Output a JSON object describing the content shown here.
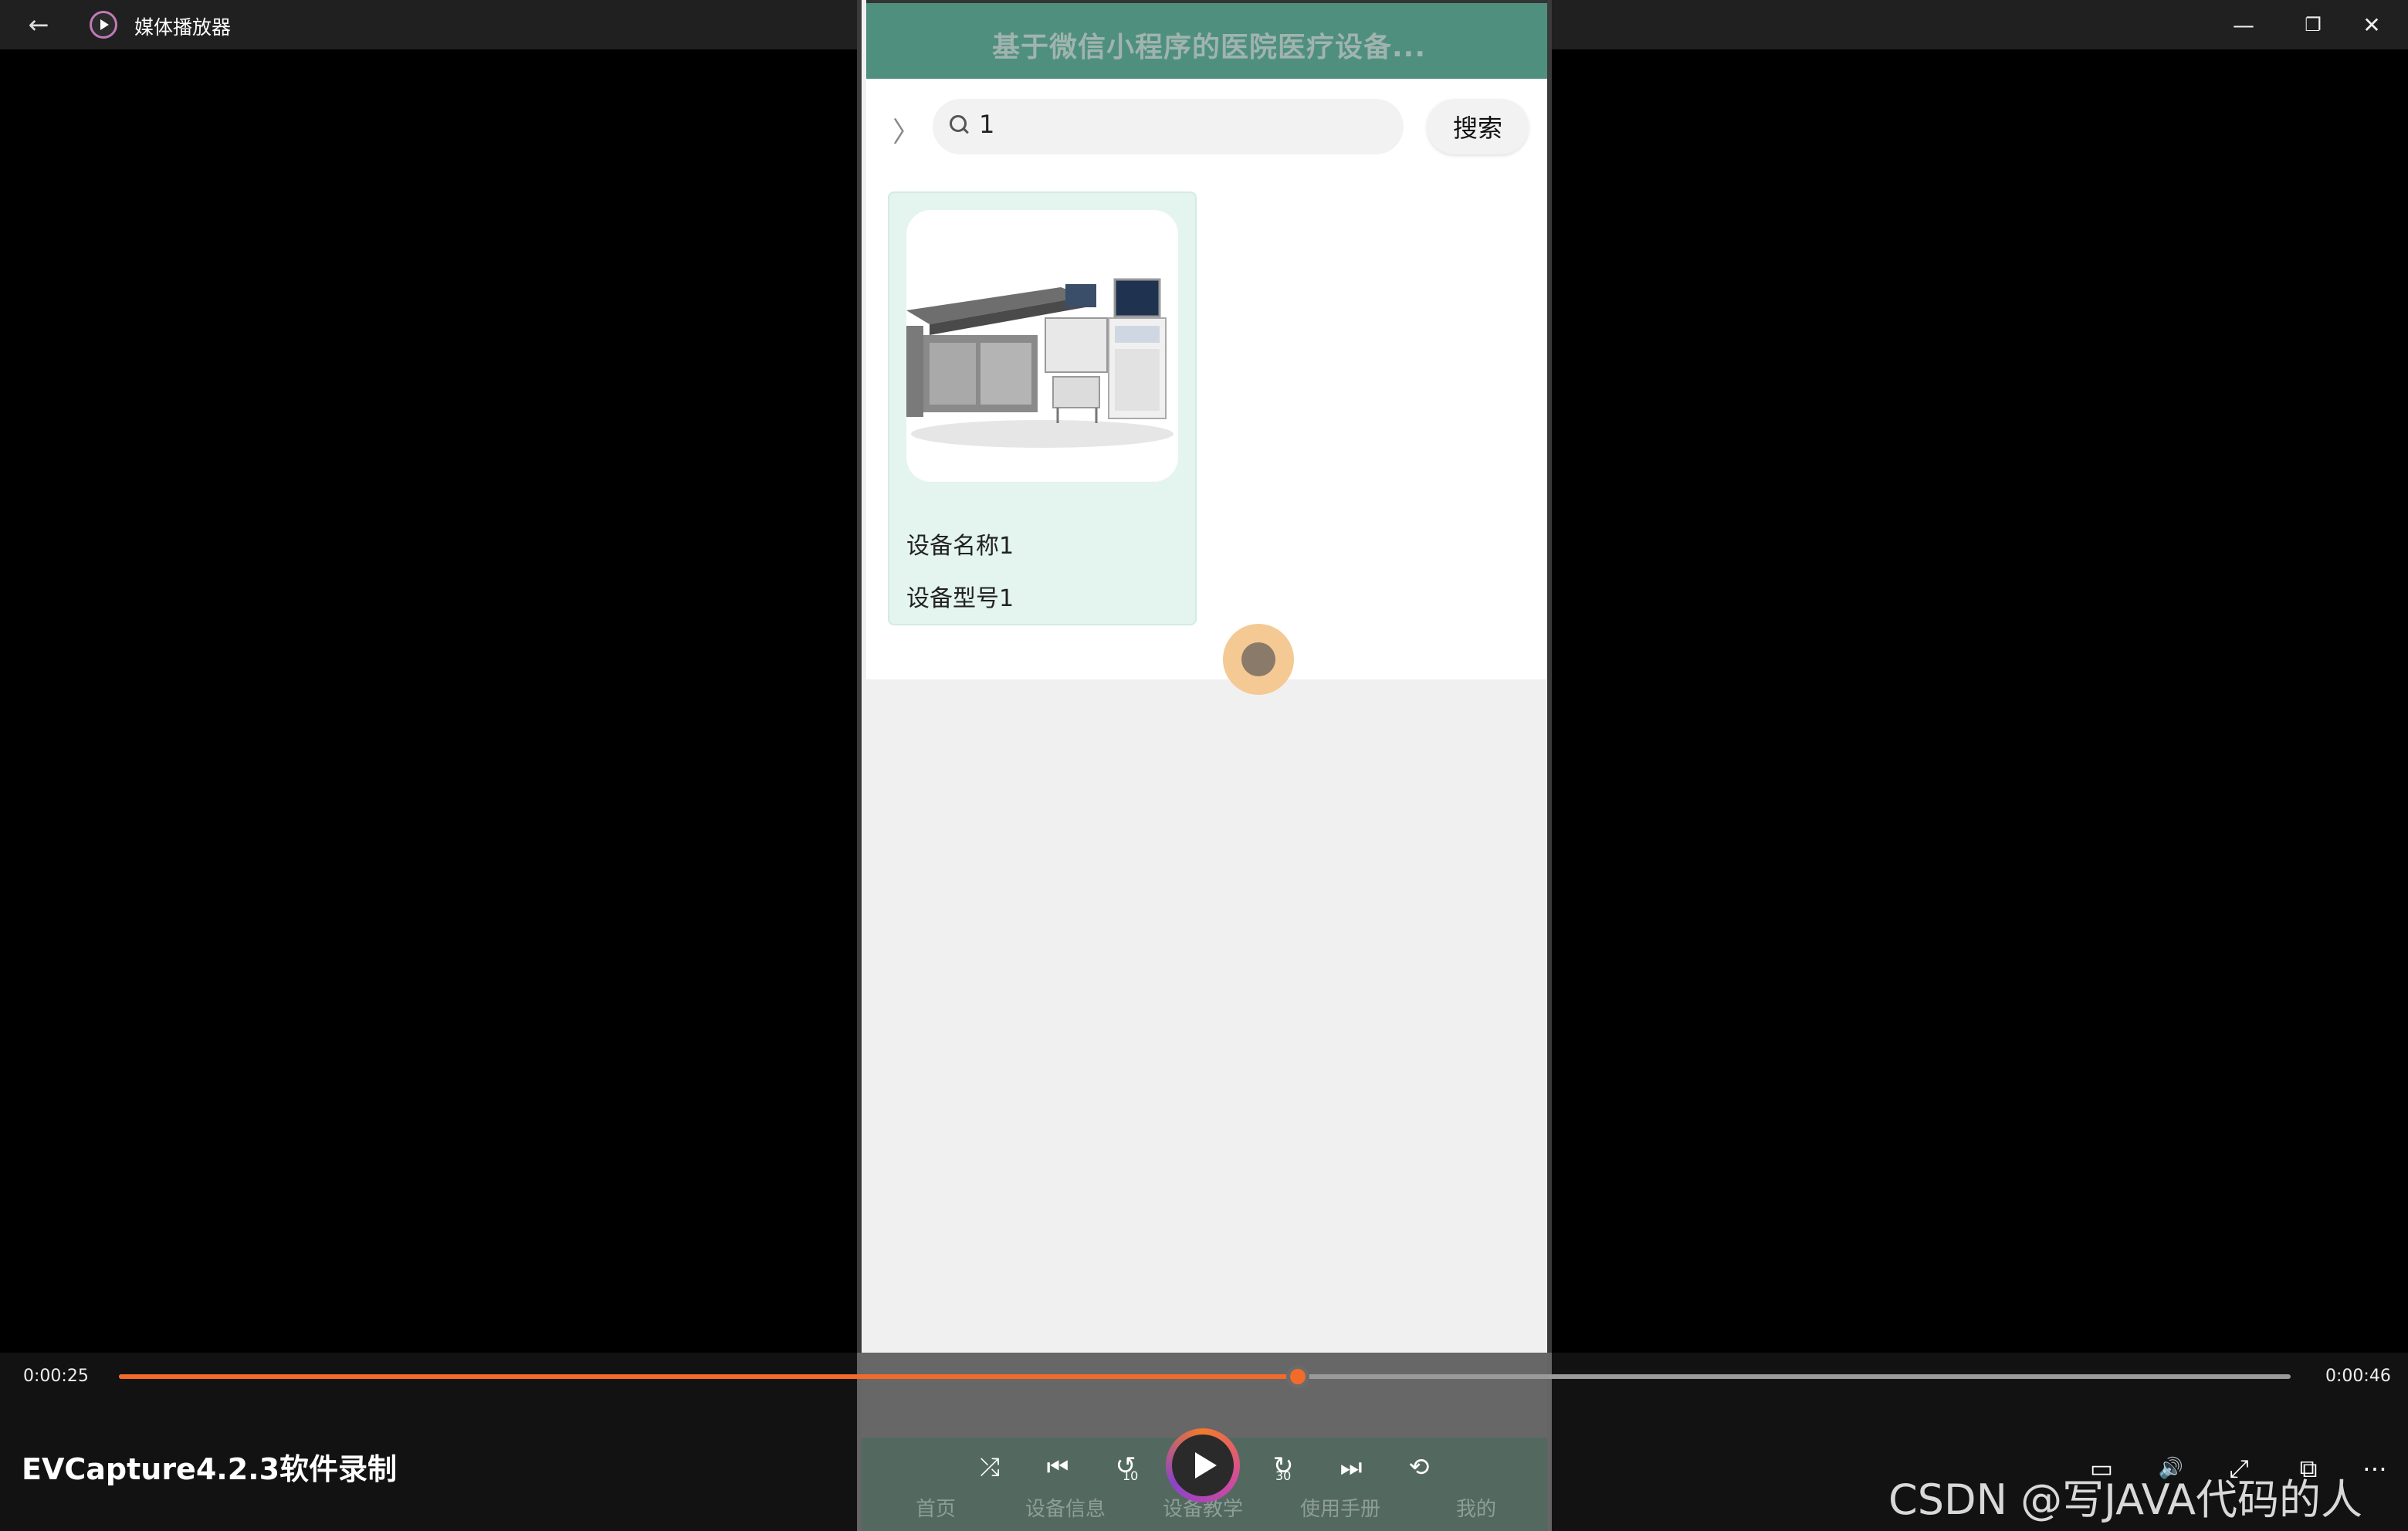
{
  "window": {
    "title": "媒体播放器",
    "back_icon": "←",
    "minimize_icon": "—",
    "restore_icon": "❐",
    "close_icon": "✕"
  },
  "phone": {
    "header_title": "基于微信小程序的医院医疗设备...",
    "search": {
      "value": "1",
      "button_label": "搜索"
    },
    "chevron": "〉",
    "card": {
      "name": "设备名称1",
      "model": "设备型号1"
    },
    "tabs": [
      "首页",
      "设备信息",
      "设备教学",
      "使用手册",
      "我的"
    ]
  },
  "player": {
    "current_time": "0:00:25",
    "total_time": "0:00:46",
    "progress_fraction": 0.543,
    "accent_color": "#f26b2a",
    "shuffle_icon": "⤮",
    "previous_icon": "⏮",
    "rewind_icon": "↺",
    "rewind_seconds": "10",
    "forward_icon": "↻",
    "forward_seconds": "30",
    "next_icon": "⏭",
    "repeat_icon": "⟲",
    "subtitles_icon": "▭",
    "volume_icon": "🔊",
    "expand_icon": "⤢",
    "miniview_icon": "⧉",
    "more_icon": "⋯"
  },
  "watermarks": {
    "left": "EVCapture4.2.3软件录制",
    "right": "CSDN @写JAVA代码的人"
  }
}
